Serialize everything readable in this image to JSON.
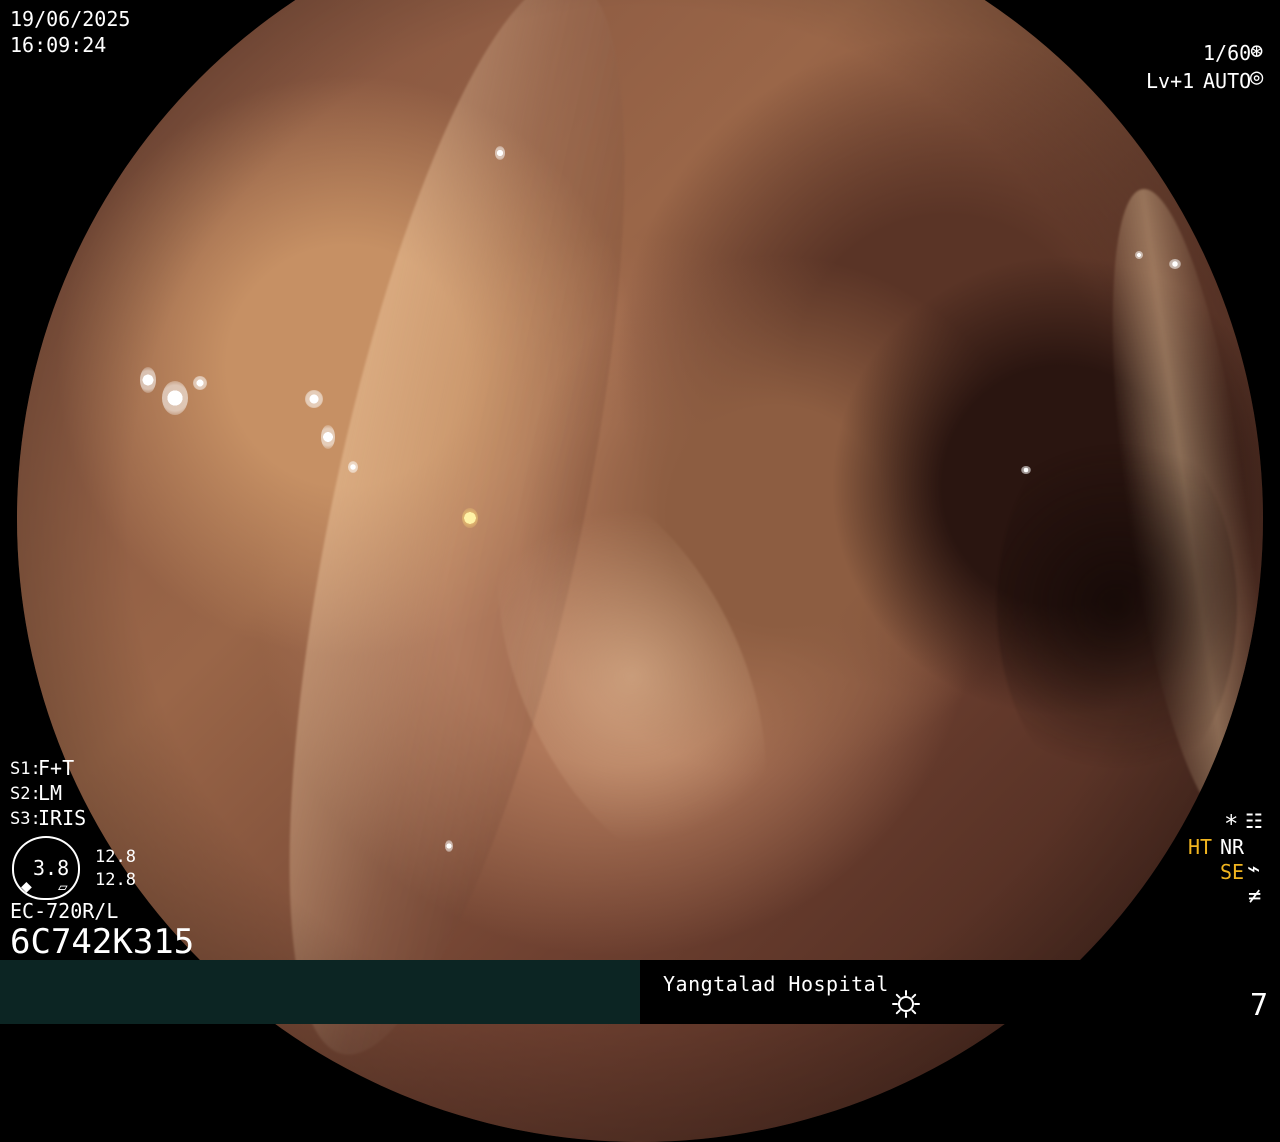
{
  "date": "19/06/2025",
  "time": "16:09:24",
  "top_right": {
    "shutter": "1/60",
    "level": "Lv+1",
    "mode": "AUTO",
    "shutter_icon": "aperture-icon",
    "auto_icon": "iris-icon"
  },
  "left_info": {
    "s1_label": "S1:",
    "s1_value": "F+T",
    "s2_label": "S2:",
    "s2_value": "LM",
    "s3_label": "S3:",
    "s3_value": "IRIS",
    "scope_value": "3.8",
    "range_top": "12.8",
    "range_bottom": "12.8",
    "model": "EC-720R/L",
    "serial": "6C742K315"
  },
  "right_info": {
    "asterisk": "*",
    "ht": "HT",
    "nr": "NR",
    "se": "SE",
    "icon_1": "settings-list-icon",
    "icon_2": "curve-icon",
    "icon_3": "not-equal-icon"
  },
  "bottom": {
    "hospital": "Yangtalad Hospital",
    "icon": "sun-icon",
    "page_number": "7"
  },
  "colors": {
    "panel_left": "#0c2523",
    "accent_yellow": "#f1b51f",
    "text": "#ffffff"
  }
}
